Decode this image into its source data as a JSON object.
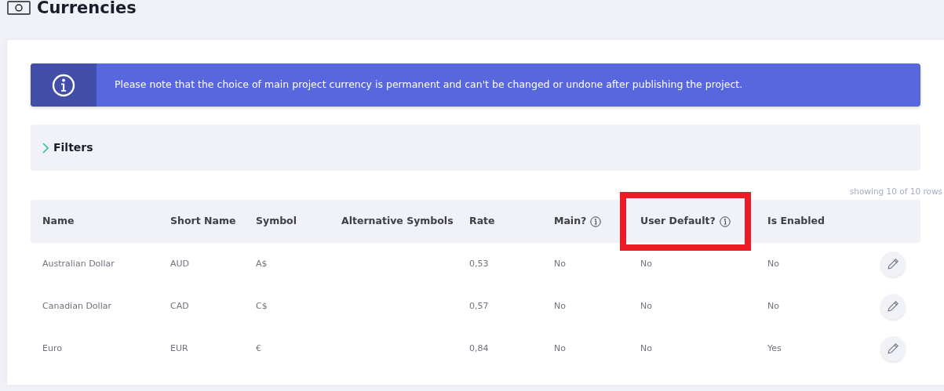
{
  "page_title": "Currencies",
  "notice": "Please note that the choice of main project currency is permanent and can't be changed or undone after publishing the project.",
  "filters": {
    "label": "Filters",
    "expanded": false
  },
  "row_count": "showing 10 of 10 rows",
  "table": {
    "columns": [
      {
        "label": "Name",
        "kind": "plain",
        "highlighted": false
      },
      {
        "label": "Short Name",
        "kind": "plain",
        "highlighted": false
      },
      {
        "label": "Symbol",
        "kind": "plain",
        "highlighted": false
      },
      {
        "label": "Alternative Symbols",
        "kind": "plain",
        "highlighted": false
      },
      {
        "label": "Rate",
        "kind": "plain",
        "highlighted": false
      },
      {
        "label": "Main?",
        "kind": "info",
        "highlighted": false
      },
      {
        "label": "User Default?",
        "kind": "info",
        "highlighted": true
      },
      {
        "label": "Is Enabled",
        "kind": "plain",
        "highlighted": false
      }
    ],
    "rows": [
      {
        "cells": [
          "Australian Dollar",
          "AUD",
          "A$",
          "",
          "0,53",
          "No",
          "No",
          "No"
        ]
      },
      {
        "cells": [
          "Canadian Dollar",
          "CAD",
          "C$",
          "",
          "0,57",
          "No",
          "No",
          "No"
        ]
      },
      {
        "cells": [
          "Euro",
          "EUR",
          "€",
          "",
          "0,84",
          "No",
          "No",
          "Yes"
        ]
      }
    ]
  }
}
